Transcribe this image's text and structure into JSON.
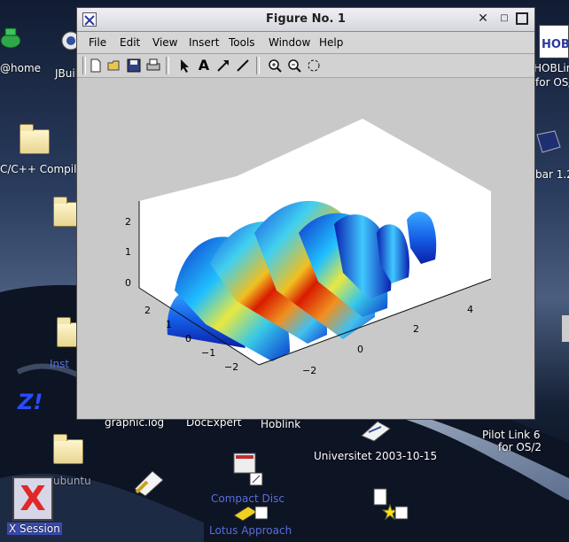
{
  "window": {
    "title": "Figure No. 1",
    "controls": {
      "close": "✕",
      "minimize": "□",
      "maximize": "□"
    }
  },
  "menubar": {
    "items": [
      "File",
      "Edit",
      "View",
      "Insert",
      "Tools",
      "Window",
      "Help"
    ]
  },
  "toolbar": {
    "tools": [
      "new-file-icon",
      "open-folder-icon",
      "save-icon",
      "print-icon",
      "arrow-pointer-icon",
      "text-icon",
      "arrow-line-icon",
      "line-icon",
      "zoom-in-icon",
      "zoom-out-icon",
      "rotate-icon"
    ],
    "text_tool_glyph": "A"
  },
  "plot": {
    "y_ticks": [
      "2",
      "1",
      "0",
      "−1",
      "−2"
    ],
    "x_ticks": [
      "4",
      "2",
      "0",
      "−2"
    ],
    "z_ticks": [
      "2",
      "1",
      "0"
    ],
    "colormap": "jet",
    "colors": {
      "background": "#ffffff",
      "axes_bg": "#c9c9c9"
    }
  },
  "desktop": {
    "icons": [
      {
        "label": "@home"
      },
      {
        "label": "JBuil"
      },
      {
        "label": "C/C++ Compile"
      },
      {
        "label": "Inst"
      },
      {
        "label": "graphic.log"
      },
      {
        "label": "DocExpert"
      },
      {
        "label": "Hoblink"
      },
      {
        "label": "Universitet 2003-10-15"
      },
      {
        "label": "Pilot Link 6"
      },
      {
        "label": "for OS/2"
      },
      {
        "label": "Compact Disc"
      },
      {
        "label": "Lotus Approach"
      },
      {
        "label": "X Session"
      },
      {
        "label": "HOBLink"
      },
      {
        "label": "for OS/"
      },
      {
        "label": "bar 1.2"
      },
      {
        "label": "ubuntu"
      }
    ],
    "x_logo": "X",
    "hob_text": "HOB",
    "z_glyph": "Z!"
  }
}
